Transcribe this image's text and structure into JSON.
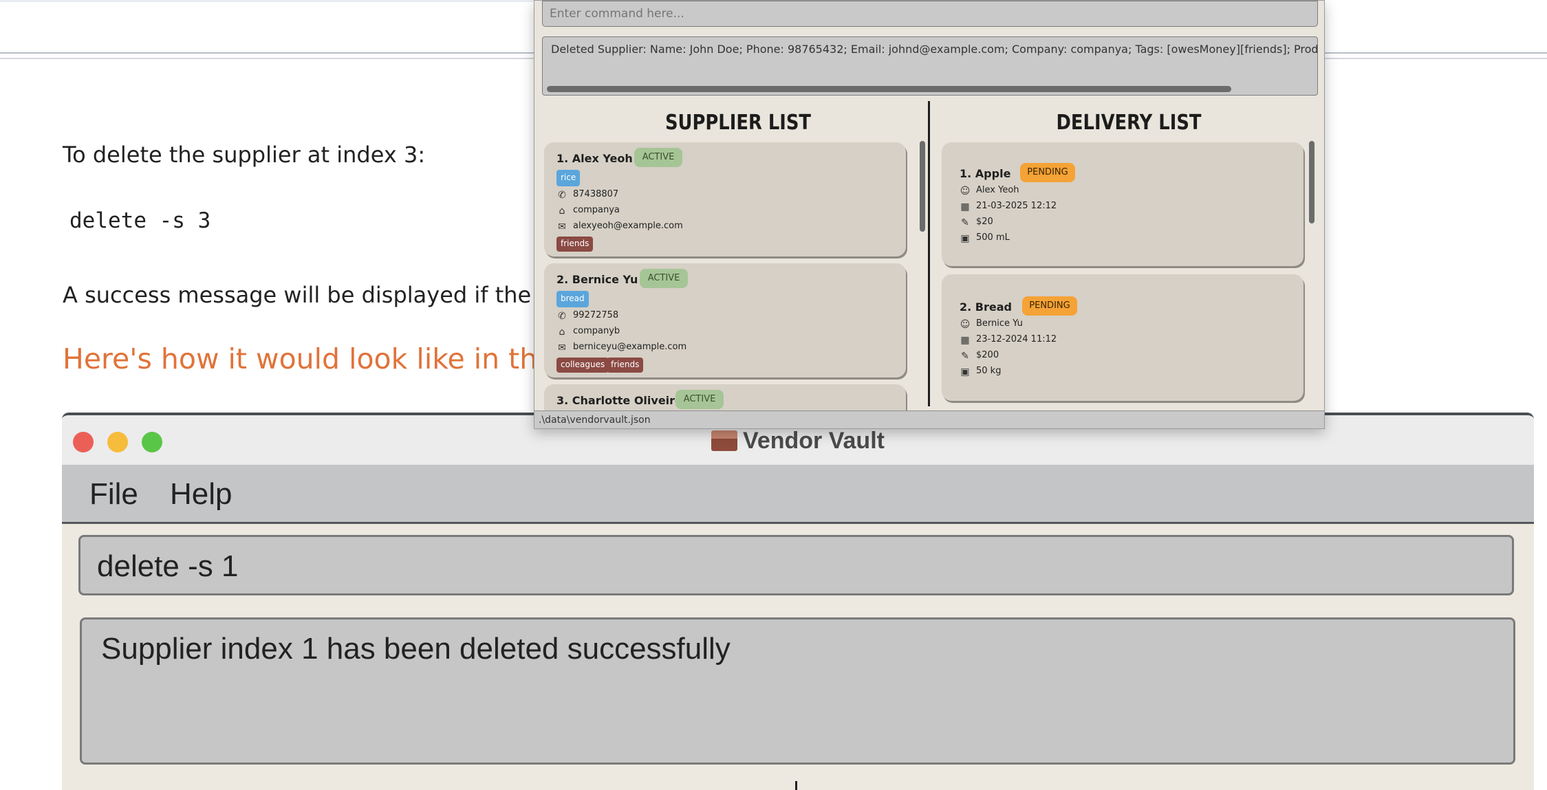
{
  "doc": {
    "line1": "To delete the supplier at index 3:",
    "code": "delete -s 3",
    "line2": "A success message will be displayed if the s",
    "heading": "Here's how it would look like in the a"
  },
  "screenshot": {
    "title": "Vendor Vault",
    "menu": [
      "File",
      "Help"
    ],
    "command": "delete -s 1",
    "result": "Supplier index 1 has been deleted successfully"
  },
  "app": {
    "command_placeholder": "Enter command here...",
    "result": "Deleted Supplier: Name: John Doe; Phone: 98765432; Email: johnd@example.com; Company: companya; Tags: [owesMoney][friends]; Products: [bread][ri",
    "supplier_title": "SUPPLIER LIST",
    "delivery_title": "DELIVERY LIST",
    "suppliers": [
      {
        "index": "1.",
        "name": "Alex Yeoh",
        "status": "ACTIVE",
        "product": "rice",
        "phone": "87438807",
        "company": "companya",
        "email": "alexyeoh@example.com",
        "tags": [
          "friends"
        ]
      },
      {
        "index": "2.",
        "name": "Bernice Yu",
        "status": "ACTIVE",
        "product": "bread",
        "phone": "99272758",
        "company": "companyb",
        "email": "berniceyu@example.com",
        "tags": [
          "colleagues",
          "friends"
        ]
      },
      {
        "index": "3.",
        "name": "Charlotte Oliveiro",
        "status": "ACTIVE"
      }
    ],
    "deliveries": [
      {
        "index": "1.",
        "product": "Apple",
        "status": "PENDING",
        "supplier": "Alex Yeoh",
        "date": "21-03-2025 12:12",
        "cost": "$20",
        "quantity": "500 mL"
      },
      {
        "index": "2.",
        "product": "Bread",
        "status": "PENDING",
        "supplier": "Bernice Yu",
        "date": "23-12-2024 11:12",
        "cost": "$200",
        "quantity": "50 kg"
      }
    ],
    "status_bar": ".\\data\\vendorvault.json"
  },
  "icons": {
    "phone": "phone-icon",
    "company": "building-icon",
    "email": "envelope-icon",
    "supplier": "person-icon",
    "date": "calendar-icon",
    "cost": "money-icon",
    "quantity": "boxes-icon"
  },
  "colors": {
    "heading_orange": "#e0733a",
    "active_badge": "#a6c596",
    "pending_badge": "#f5a236",
    "product_tag": "#5aa6dc",
    "tag": "#8b4a44"
  }
}
